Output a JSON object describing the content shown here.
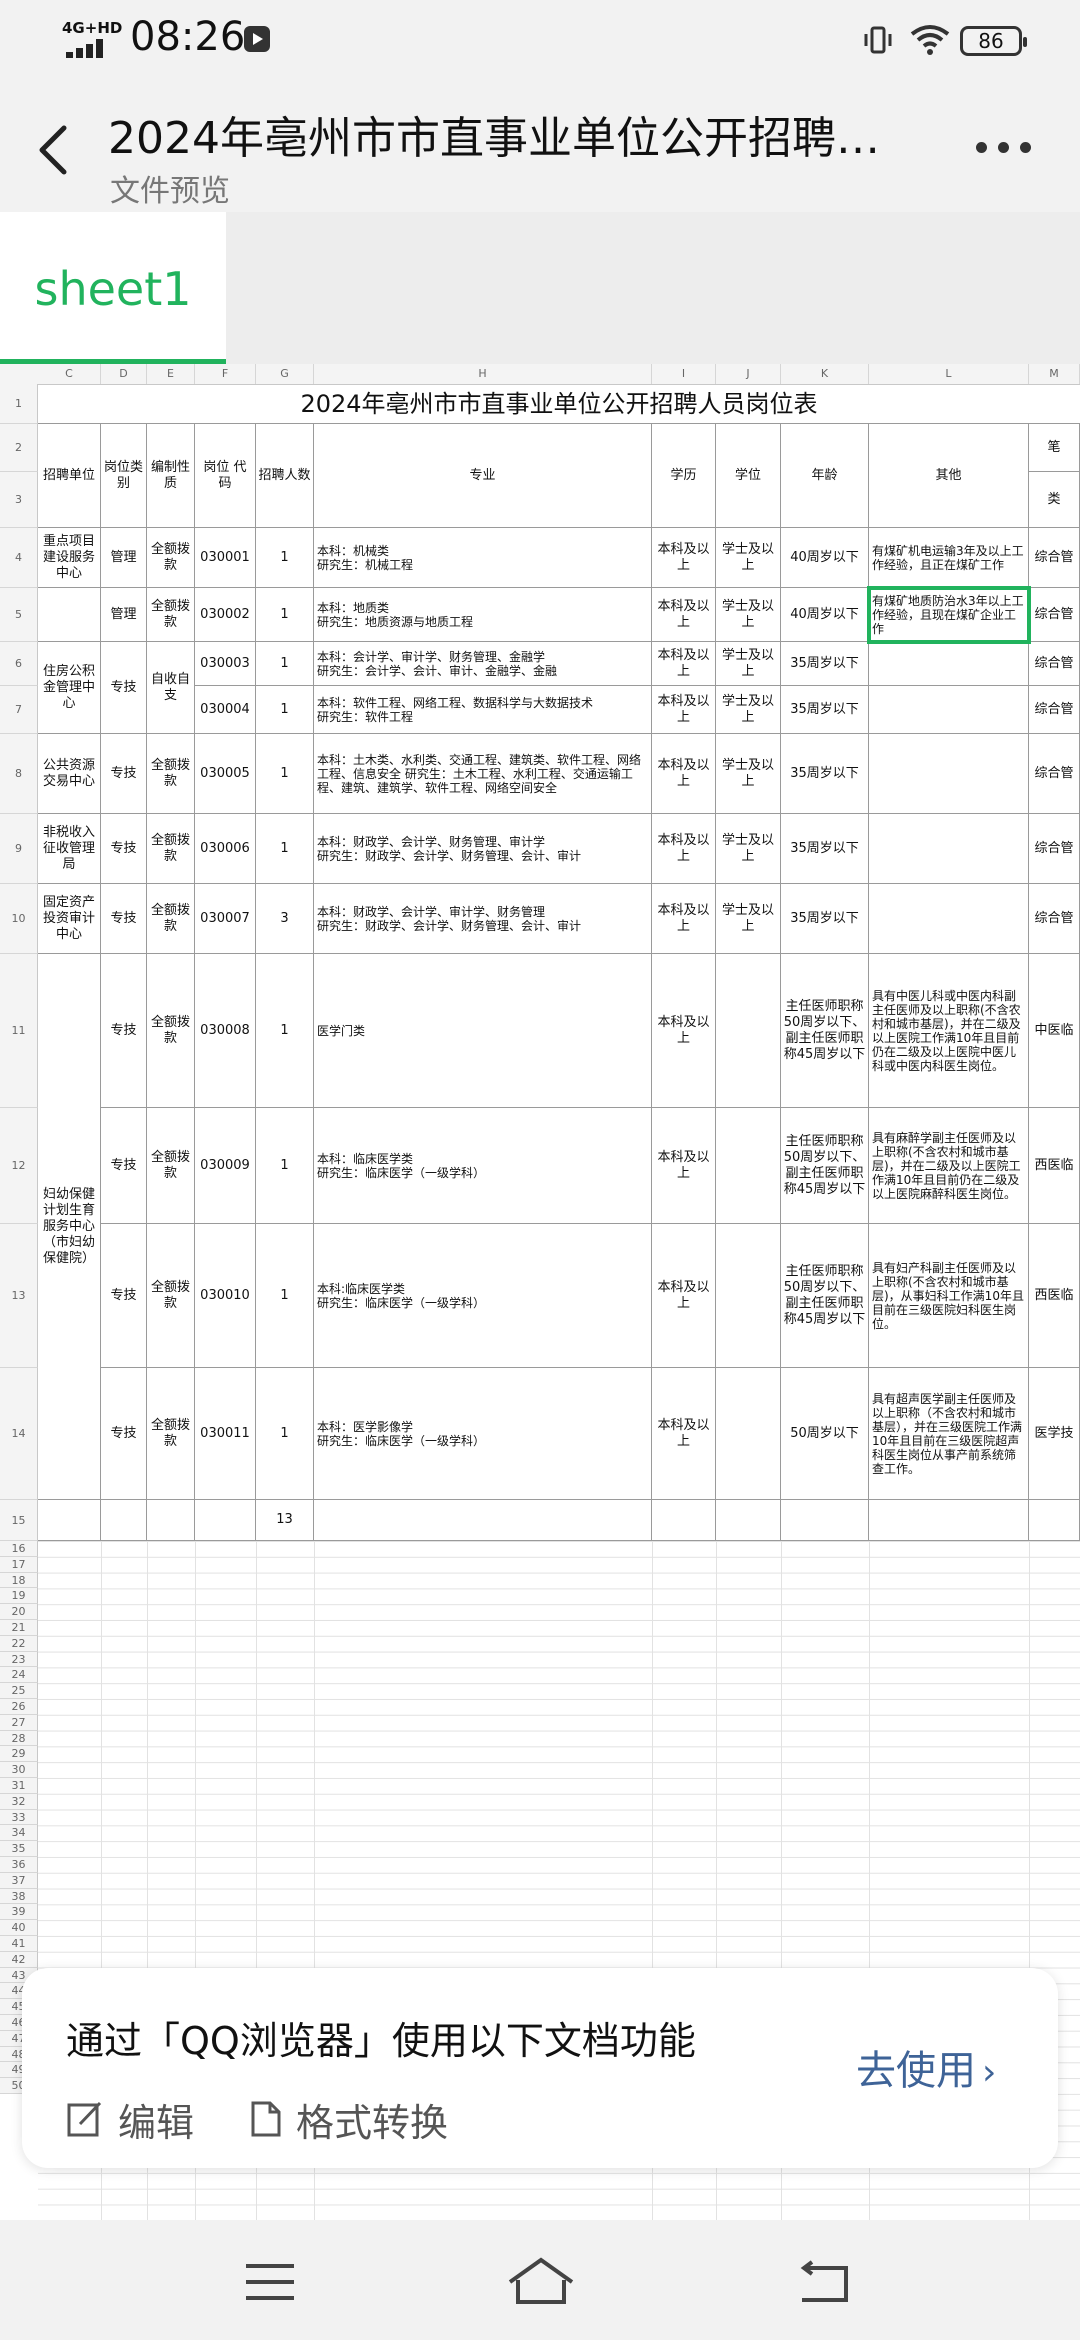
{
  "status_bar": {
    "network": "4G+HD",
    "time": "08:26",
    "battery": "86"
  },
  "header": {
    "title": "2024年亳州市市直事业单位公开招聘…",
    "subtitle": "文件预览"
  },
  "tabs": [
    {
      "label": "sheet1",
      "active": true
    }
  ],
  "spreadsheet": {
    "column_headers": [
      "C",
      "D",
      "E",
      "F",
      "G",
      "H",
      "I",
      "J",
      "K",
      "L",
      "M"
    ],
    "title": "2024年亳州市市直事业单位公开招聘人员岗位表",
    "table_headers": {
      "unit": "招聘单位",
      "post_type": "岗位类别",
      "staffing": "编制性质",
      "post_code": "岗位 代码",
      "count": "招聘人数",
      "major": "专业",
      "education": "学历",
      "degree": "学位",
      "age": "年龄",
      "other": "其他",
      "next_col": "笔",
      "next_col_sub": "类"
    },
    "rows": [
      {
        "unit": "重点项目建设服务中心",
        "type": "管理",
        "staffing": "全额拨款",
        "code": "030001",
        "count": "1",
        "major": "本科：机械类\n研究生：机械工程",
        "edu": "本科及以上",
        "degree": "学士及以上",
        "age": "40周岁以下",
        "other": "有煤矿机电运输3年及以上工作经验，且正在煤矿工作",
        "next": "综合管"
      },
      {
        "unit": "",
        "type": "管理",
        "staffing": "全额拨款",
        "code": "030002",
        "count": "1",
        "major": "本科：地质类\n研究生：地质资源与地质工程",
        "edu": "本科及以上",
        "degree": "学士及以上",
        "age": "40周岁以下",
        "other": "有煤矿地质防治水3年以上工作经验，且现在煤矿企业工作",
        "next": "综合管"
      },
      {
        "unit": "住房公积金管理中心",
        "type": "专技",
        "staffing": "自收自支",
        "code": "030003",
        "count": "1",
        "major": "本科：会计学、审计学、财务管理、金融学\n研究生：会计学、会计、审计、金融学、金融",
        "edu": "本科及以上",
        "degree": "学士及以上",
        "age": "35周岁以下",
        "other": "",
        "next": "综合管"
      },
      {
        "unit": "",
        "type": "",
        "staffing": "",
        "code": "030004",
        "count": "1",
        "major": "本科：软件工程、网络工程、数据科学与大数据技术\n研究生：软件工程",
        "edu": "本科及以上",
        "degree": "学士及以上",
        "age": "35周岁以下",
        "other": "",
        "next": "综合管"
      },
      {
        "unit": "公共资源交易中心",
        "type": "专技",
        "staffing": "全额拨款",
        "code": "030005",
        "count": "1",
        "major": "本科：土木类、水利类、交通工程、建筑类、软件工程、网络工程、信息安全 研究生：土木工程、水利工程、交通运输工程、建筑、建筑学、软件工程、网络空间安全",
        "edu": "本科及以上",
        "degree": "学士及以上",
        "age": "35周岁以下",
        "other": "",
        "next": "综合管"
      },
      {
        "unit": "非税收入征收管理局",
        "type": "专技",
        "staffing": "全额拨款",
        "code": "030006",
        "count": "1",
        "major": "本科：财政学、会计学、财务管理、审计学\n研究生：财政学、会计学、财务管理、会计、审计",
        "edu": "本科及以上",
        "degree": "学士及以上",
        "age": "35周岁以下",
        "other": "",
        "next": "综合管"
      },
      {
        "unit": "固定资产投资审计中心",
        "type": "专技",
        "staffing": "全额拨款",
        "code": "030007",
        "count": "3",
        "major": "本科：财政学、会计学、审计学、财务管理\n研究生：财政学、会计学、财务管理、会计、审计",
        "edu": "本科及以上",
        "degree": "学士及以上",
        "age": "35周岁以下",
        "other": "",
        "next": "综合管"
      },
      {
        "unit": "妇幼保健计划生育服务中心（市妇幼保健院）",
        "type": "专技",
        "staffing": "全额拨款",
        "code": "030008",
        "count": "1",
        "major": "医学门类",
        "edu": "本科及以上",
        "degree": "",
        "age": "主任医师职称50周岁以下、副主任医师职称45周岁以下",
        "other": "具有中医儿科或中医内科副主任医师及以上职称(不含农村和城市基层)，并在二级及以上医院工作满10年且目前仍在二级及以上医院中医儿科或中医内科医生岗位。",
        "next": "中医临"
      },
      {
        "unit": "",
        "type": "专技",
        "staffing": "全额拨款",
        "code": "030009",
        "count": "1",
        "major": "本科：临床医学类\n研究生：临床医学（一级学科）",
        "edu": "本科及以上",
        "degree": "",
        "age": "主任医师职称50周岁以下、副主任医师职称45周岁以下",
        "other": "具有麻醉学副主任医师及以上职称(不含农村和城市基层)，并在二级及以上医院工作满10年且目前仍在二级及以上医院麻醉科医生岗位。",
        "next": "西医临"
      },
      {
        "unit": "",
        "type": "专技",
        "staffing": "全额拨款",
        "code": "030010",
        "count": "1",
        "major": "本科:临床医学类\n研究生：临床医学（一级学科）",
        "edu": "本科及以上",
        "degree": "",
        "age": "主任医师职称50周岁以下、副主任医师职称45周岁以下",
        "other": "具有妇产科副主任医师及以上职称(不含农村和城市基层)，从事妇科工作满10年且目前在三级医院妇科医生岗位。",
        "next": "西医临"
      },
      {
        "unit": "",
        "type": "专技",
        "staffing": "全额拨款",
        "code": "030011",
        "count": "1",
        "major": "本科：医学影像学\n研究生：临床医学（一级学科）",
        "edu": "本科及以上",
        "degree": "",
        "age": "50周岁以下",
        "other": "具有超声医学副主任医师及以上职称（不含农村和城市基层），并在三级医院工作满10年且目前在三级医院超声科医生岗位从事产前系统筛查工作。",
        "next": "医学技"
      }
    ],
    "total_count": "13",
    "row_numbers": [
      "1",
      "2",
      "3",
      "4",
      "5",
      "6",
      "7",
      "8",
      "9",
      "10",
      "11",
      "12",
      "13",
      "14",
      "15",
      "16",
      "17",
      "18",
      "19",
      "20",
      "21",
      "22",
      "23",
      "24",
      "25",
      "26",
      "27",
      "28",
      "29",
      "30",
      "31",
      "32",
      "33",
      "34",
      "35",
      "36",
      "37",
      "38",
      "39",
      "40",
      "41",
      "42",
      "43",
      "44",
      "45",
      "46",
      "47",
      "48",
      "49",
      "50"
    ]
  },
  "promo": {
    "text": "通过「QQ浏览器」使用以下文档功能",
    "edit_label": "编辑",
    "convert_label": "格式转换",
    "go_label": "去使用"
  },
  "accent_color": "#21b35d",
  "link_color": "#3e6397"
}
